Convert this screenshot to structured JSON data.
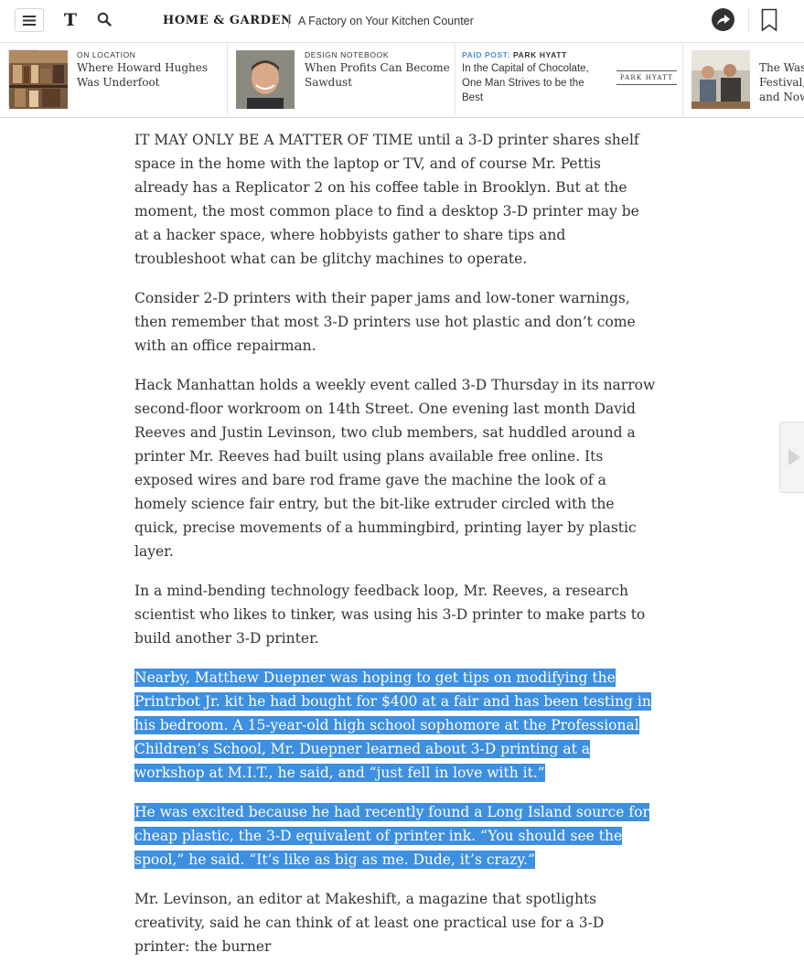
{
  "header": {
    "logo": "T",
    "section": "HOME & GARDEN",
    "article_title": "A Factory on Your Kitchen Counter"
  },
  "ribbon": {
    "items": [
      {
        "kicker": "ON LOCATION",
        "title": "Where Howard Hughes Was Underfoot"
      },
      {
        "kicker": "DESIGN NOTEBOOK",
        "title": "When Profits Can Become Sawdust"
      },
      {
        "kicker_label": "PAID POST:",
        "sponsor": "PARK HYATT",
        "title": "In the Capital of Chocolate, One Man Strives to be the Best",
        "sponsor_logo": "PARK HYATT"
      },
      {
        "title": "The Was Festival, and Now"
      }
    ]
  },
  "article": {
    "paragraphs": [
      "IT MAY ONLY BE A MATTER OF TIME until a 3-D printer shares shelf space in the home with the laptop or TV, and of course Mr. Pettis already has a Replicator 2 on his coffee table in Brooklyn. But at the moment, the most common place to find a desktop 3-D printer may be at a hacker space, where hobbyists gather to share tips and troubleshoot what can be glitchy machines to operate.",
      "Consider 2-D printers with their paper jams and low-toner warnings, then remember that most 3-D printers use hot plastic and don’t come with an office repairman.",
      "Hack Manhattan holds a weekly event called 3-D Thursday in its narrow second-floor workroom on 14th Street. One evening last month David Reeves and Justin Levinson, two club members, sat huddled around a printer Mr. Reeves had built using plans available free online. Its exposed wires and bare rod frame gave the machine the look of a homely science fair entry, but the bit-like extruder circled with the quick, precise movements of a hummingbird, printing layer by plastic layer.",
      "In a mind-bending technology feedback loop, Mr. Reeves, a research scientist who likes to tinker, was using his 3-D printer to make parts to build another 3-D printer.",
      "Nearby, Matthew Duepner was hoping to get tips on modifying the Printrbot Jr. kit he had bought for $400 at a fair and has been testing in his bedroom. A 15-year-old high school sophomore at the Professional Children’s School, Mr. Duepner learned about 3-D printing at a workshop at M.I.T., he said, and “just fell in love with it.”",
      "He was excited because he had recently found a Long Island source for cheap plastic, the 3-D equivalent of printer ink. “You should see the spool,” he said. “It’s like as big as me. Dude, it’s crazy.”",
      "Mr. Levinson, an editor at Makeshift, a magazine that spotlights creativity, said he can think of at least one practical use for a 3-D printer: the burner"
    ],
    "selected_paragraphs": [
      4,
      5
    ]
  },
  "colors": {
    "selection": "#3d8fe0",
    "paid_post": "#4a90d9",
    "text": "#333333"
  }
}
